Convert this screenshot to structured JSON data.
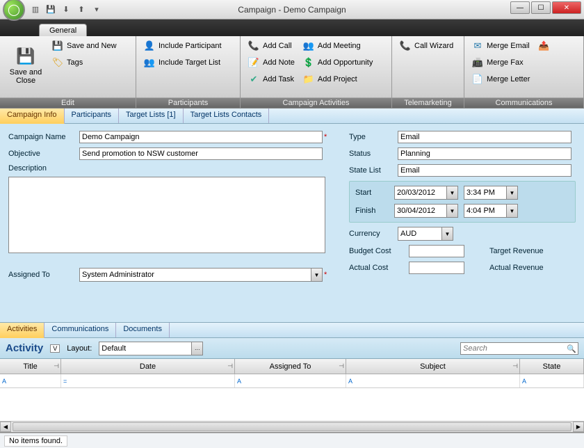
{
  "window": {
    "title": "Campaign - Demo Campaign"
  },
  "ribbon": {
    "tab": "General",
    "groups": {
      "edit": {
        "label": "Edit",
        "save_close": "Save and Close",
        "save_new": "Save and New",
        "tags": "Tags"
      },
      "participants": {
        "label": "Participants",
        "include_participant": "Include Participant",
        "include_target_list": "Include Target List"
      },
      "activities": {
        "label": "Campaign Activities",
        "add_call": "Add Call",
        "add_note": "Add Note",
        "add_task": "Add Task",
        "add_meeting": "Add Meeting",
        "add_opportunity": "Add Opportunity",
        "add_project": "Add Project"
      },
      "telemarketing": {
        "label": "Telemarketing",
        "call_wizard": "Call Wizard"
      },
      "communications": {
        "label": "Communications",
        "merge_email": "Merge Email",
        "merge_fax": "Merge Fax",
        "merge_letter": "Merge Letter"
      }
    }
  },
  "subtabs": {
    "campaign_info": "Campaign Info",
    "participants": "Participants",
    "target_lists": "Target Lists [1]",
    "target_lists_contacts": "Target Lists Contacts"
  },
  "form": {
    "labels": {
      "campaign_name": "Campaign Name",
      "objective": "Objective",
      "description": "Description",
      "assigned_to": "Assigned To",
      "type": "Type",
      "status": "Status",
      "state_list": "State List",
      "start": "Start",
      "finish": "Finish",
      "currency": "Currency",
      "budget_cost": "Budget Cost",
      "actual_cost": "Actual Cost",
      "target_revenue": "Target Revenue",
      "actual_revenue": "Actual Revenue"
    },
    "values": {
      "campaign_name": "Demo Campaign",
      "objective": "Send promotion to NSW customer",
      "description": "",
      "assigned_to": "System Administrator",
      "type": "Email",
      "status": "Planning",
      "state_list": "Email",
      "start_date": "20/03/2012",
      "start_time": "3:34 PM",
      "finish_date": "30/04/2012",
      "finish_time": "4:04 PM",
      "currency": "AUD",
      "budget_cost": "",
      "actual_cost": "",
      "target_revenue": "",
      "actual_revenue": ""
    }
  },
  "lowtabs": {
    "activities": "Activities",
    "communications": "Communications",
    "documents": "Documents"
  },
  "activity": {
    "title": "Activity",
    "layout_label": "Layout:",
    "layout_value": "Default",
    "search_placeholder": "Search",
    "columns": {
      "title": "Title",
      "date": "Date",
      "assigned_to": "Assigned To",
      "subject": "Subject",
      "state": "State"
    }
  },
  "status": "No items found."
}
